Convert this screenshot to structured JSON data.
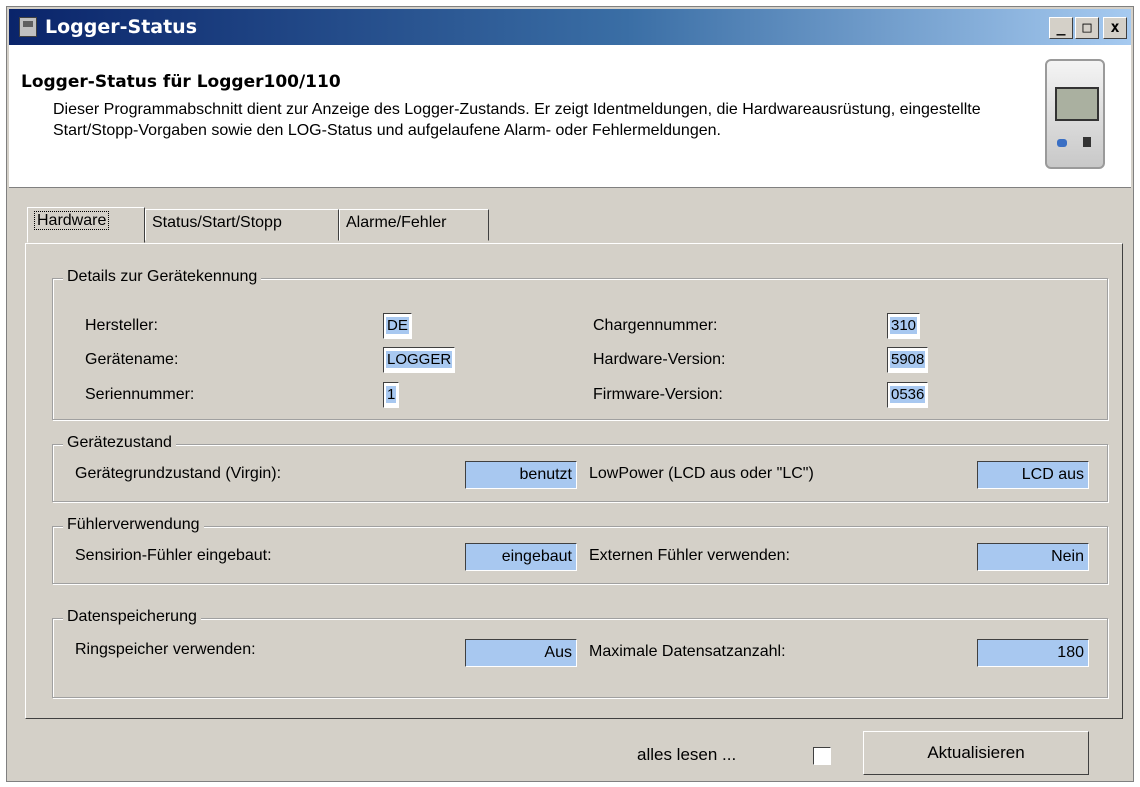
{
  "window": {
    "title": "Logger-Status",
    "controls": {
      "minimize": "_",
      "maximize": "□",
      "close": "x"
    }
  },
  "header": {
    "title": "Logger-Status für Logger100/110",
    "description": "Dieser Programmabschnitt dient zur Anzeige des Logger-Zustands. Er zeigt Identmeldungen, die Hardwareausrüstung, eingestellte Start/Stopp-Vorgaben sowie den LOG-Status und aufgelaufene Alarm- oder Fehlermeldungen."
  },
  "tabs": [
    {
      "label": "Hardware",
      "active": true
    },
    {
      "label": "Status/Start/Stopp",
      "active": false
    },
    {
      "label": "Alarme/Fehler",
      "active": false
    }
  ],
  "groups": {
    "identification": {
      "legend": "Details zur Gerätekennung",
      "fields": [
        {
          "label": "Hersteller:",
          "value": "DE"
        },
        {
          "label": "Gerätename:",
          "value": "LOGGER"
        },
        {
          "label": "Seriennummer:",
          "value": "1"
        },
        {
          "label": "Chargennummer:",
          "value": "310"
        },
        {
          "label": "Hardware-Version:",
          "value": "5908"
        },
        {
          "label": "Firmware-Version:",
          "value": "0536"
        }
      ]
    },
    "state": {
      "legend": "Gerätezustand",
      "left": {
        "label": "Gerätegrundzustand (Virgin):",
        "value": "benutzt"
      },
      "right": {
        "label": "LowPower (LCD aus oder \"LC\")",
        "value": "LCD aus"
      }
    },
    "sensor": {
      "legend": "Fühlerverwendung",
      "left": {
        "label": "Sensirion-Fühler eingebaut:",
        "value": "eingebaut"
      },
      "right": {
        "label": "Externen Fühler verwenden:",
        "value": "Nein"
      }
    },
    "storage": {
      "legend": "Datenspeicherung",
      "left": {
        "label": "Ringspeicher verwenden:",
        "value": "Aus"
      },
      "right": {
        "label": "Maximale Datensatzanzahl:",
        "value": "180"
      }
    }
  },
  "footer": {
    "read_all_label": "alles lesen ...",
    "read_all_checked": false,
    "refresh_button": "Aktualisieren"
  },
  "colors": {
    "value_highlight": "#a8c8f0",
    "titlebar_start": "#0a246a",
    "face": "#d4d0c8"
  }
}
